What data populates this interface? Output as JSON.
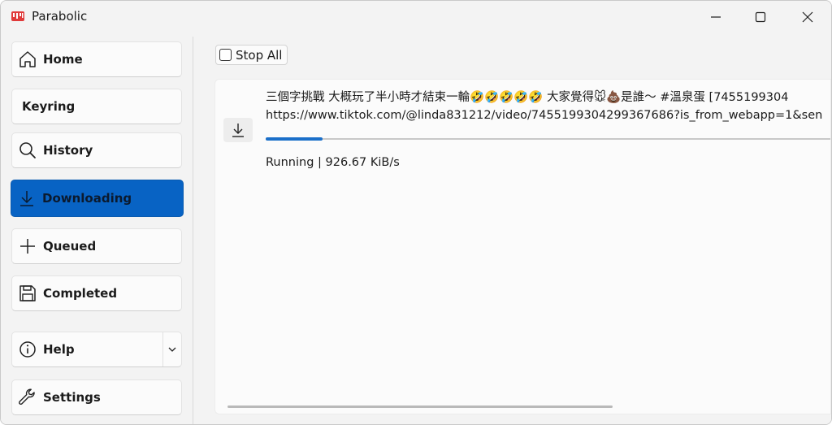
{
  "window": {
    "title": "Parabolic",
    "controls": [
      "minimize-icon",
      "maximize-icon",
      "close-icon"
    ]
  },
  "sidebar": {
    "items": [
      {
        "label": "Home",
        "icon": "home-icon",
        "active": false
      },
      {
        "label": "Keyring",
        "icon": "",
        "active": false
      },
      {
        "label": "History",
        "icon": "search-icon",
        "active": false
      },
      {
        "label": "Downloading",
        "icon": "download-icon",
        "active": true
      },
      {
        "label": "Queued",
        "icon": "plus-icon",
        "active": false
      },
      {
        "label": "Completed",
        "icon": "save-icon",
        "active": false
      },
      {
        "label": "Help",
        "icon": "info-icon",
        "active": false,
        "expandable": true
      },
      {
        "label": "Settings",
        "icon": "wrench-icon",
        "active": false
      }
    ]
  },
  "toolbar": {
    "stop_all_label": "Stop All",
    "stop_all_checked": false
  },
  "downloads": [
    {
      "title": "三個字挑戰 大概玩了半小時才結束一輪🤣🤣🤣🤣🤣 大家覺得🐭💩是誰～ #溫泉蛋 [7455199304",
      "url": "https://www.tiktok.com/@linda831212/video/7455199304299367686?is_from_webapp=1&sen",
      "status": "Running | 926.67 KiB/s",
      "progress": 0.1
    }
  ],
  "colors": {
    "accent": "#0863c4",
    "progress": "#1a6fc9",
    "app_icon": "#e03a3a"
  }
}
